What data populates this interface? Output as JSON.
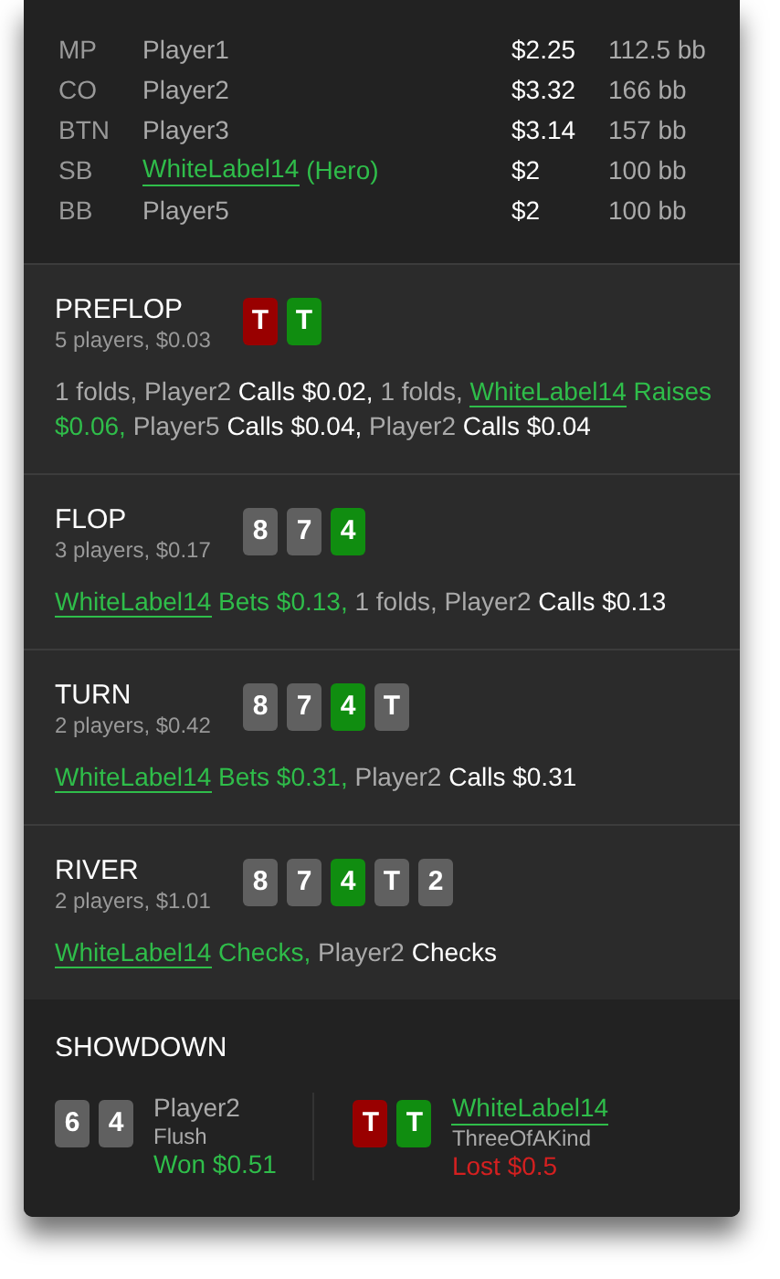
{
  "players": [
    {
      "position": "MP",
      "name": "Player1",
      "hero": false,
      "stack": "$2.25",
      "bb": "112.5 bb"
    },
    {
      "position": "CO",
      "name": "Player2",
      "hero": false,
      "stack": "$3.32",
      "bb": "166 bb"
    },
    {
      "position": "BTN",
      "name": "Player3",
      "hero": false,
      "stack": "$3.14",
      "bb": "157 bb"
    },
    {
      "position": "SB",
      "name": "WhiteLabel14",
      "suffix": "(Hero)",
      "hero": true,
      "stack": "$2",
      "bb": "100 bb"
    },
    {
      "position": "BB",
      "name": "Player5",
      "hero": false,
      "stack": "$2",
      "bb": "100 bb"
    }
  ],
  "streets": [
    {
      "title": "PREFLOP",
      "info": "5 players, $0.03",
      "cards": [
        {
          "rank": "T",
          "color": "#990000"
        },
        {
          "rank": "T",
          "color": "#108d10"
        }
      ],
      "actions": [
        {
          "kind": "fold",
          "text": "1 folds,"
        },
        {
          "kind": "player",
          "player": "Player2",
          "action": "Calls $0.02,",
          "hero": false
        },
        {
          "kind": "fold",
          "text": "1 folds,"
        },
        {
          "kind": "player",
          "player": "WhiteLabel14",
          "action": "Raises $0.06,",
          "hero": true
        },
        {
          "kind": "player",
          "player": "Player5",
          "action": "Calls $0.04,",
          "hero": false
        },
        {
          "kind": "player",
          "player": "Player2",
          "action": "Calls $0.04",
          "hero": false
        }
      ]
    },
    {
      "title": "FLOP",
      "info": "3 players, $0.17",
      "cards": [
        {
          "rank": "8",
          "color": "#606060"
        },
        {
          "rank": "7",
          "color": "#606060"
        },
        {
          "rank": "4",
          "color": "#108d10"
        }
      ],
      "actions": [
        {
          "kind": "player",
          "player": "WhiteLabel14",
          "action": "Bets $0.13,",
          "hero": true
        },
        {
          "kind": "fold",
          "text": "1 folds,"
        },
        {
          "kind": "player",
          "player": "Player2",
          "action": "Calls $0.13",
          "hero": false
        }
      ]
    },
    {
      "title": "TURN",
      "info": "2 players, $0.42",
      "cards": [
        {
          "rank": "8",
          "color": "#606060"
        },
        {
          "rank": "7",
          "color": "#606060"
        },
        {
          "rank": "4",
          "color": "#108d10"
        },
        {
          "rank": "T",
          "color": "#606060"
        }
      ],
      "actions": [
        {
          "kind": "player",
          "player": "WhiteLabel14",
          "action": "Bets $0.31,",
          "hero": true
        },
        {
          "kind": "player",
          "player": "Player2",
          "action": "Calls $0.31",
          "hero": false
        }
      ]
    },
    {
      "title": "RIVER",
      "info": "2 players, $1.01",
      "cards": [
        {
          "rank": "8",
          "color": "#606060"
        },
        {
          "rank": "7",
          "color": "#606060"
        },
        {
          "rank": "4",
          "color": "#108d10"
        },
        {
          "rank": "T",
          "color": "#606060"
        },
        {
          "rank": "2",
          "color": "#606060"
        }
      ],
      "actions": [
        {
          "kind": "player",
          "player": "WhiteLabel14",
          "action": "Checks,",
          "hero": true
        },
        {
          "kind": "player",
          "player": "Player2",
          "action": "Checks",
          "hero": false
        }
      ]
    }
  ],
  "showdown": {
    "title": "SHOWDOWN",
    "hands": [
      {
        "cards": [
          {
            "rank": "6",
            "color": "#606060"
          },
          {
            "rank": "4",
            "color": "#606060"
          }
        ],
        "player": "Player2",
        "hero": false,
        "hand": "Flush",
        "result": "Won $0.51",
        "won": true
      },
      {
        "cards": [
          {
            "rank": "T",
            "color": "#990000"
          },
          {
            "rank": "T",
            "color": "#108d10"
          }
        ],
        "player": "WhiteLabel14",
        "hero": true,
        "hand": "ThreeOfAKind",
        "result": "Lost $0.5",
        "won": false
      }
    ]
  }
}
